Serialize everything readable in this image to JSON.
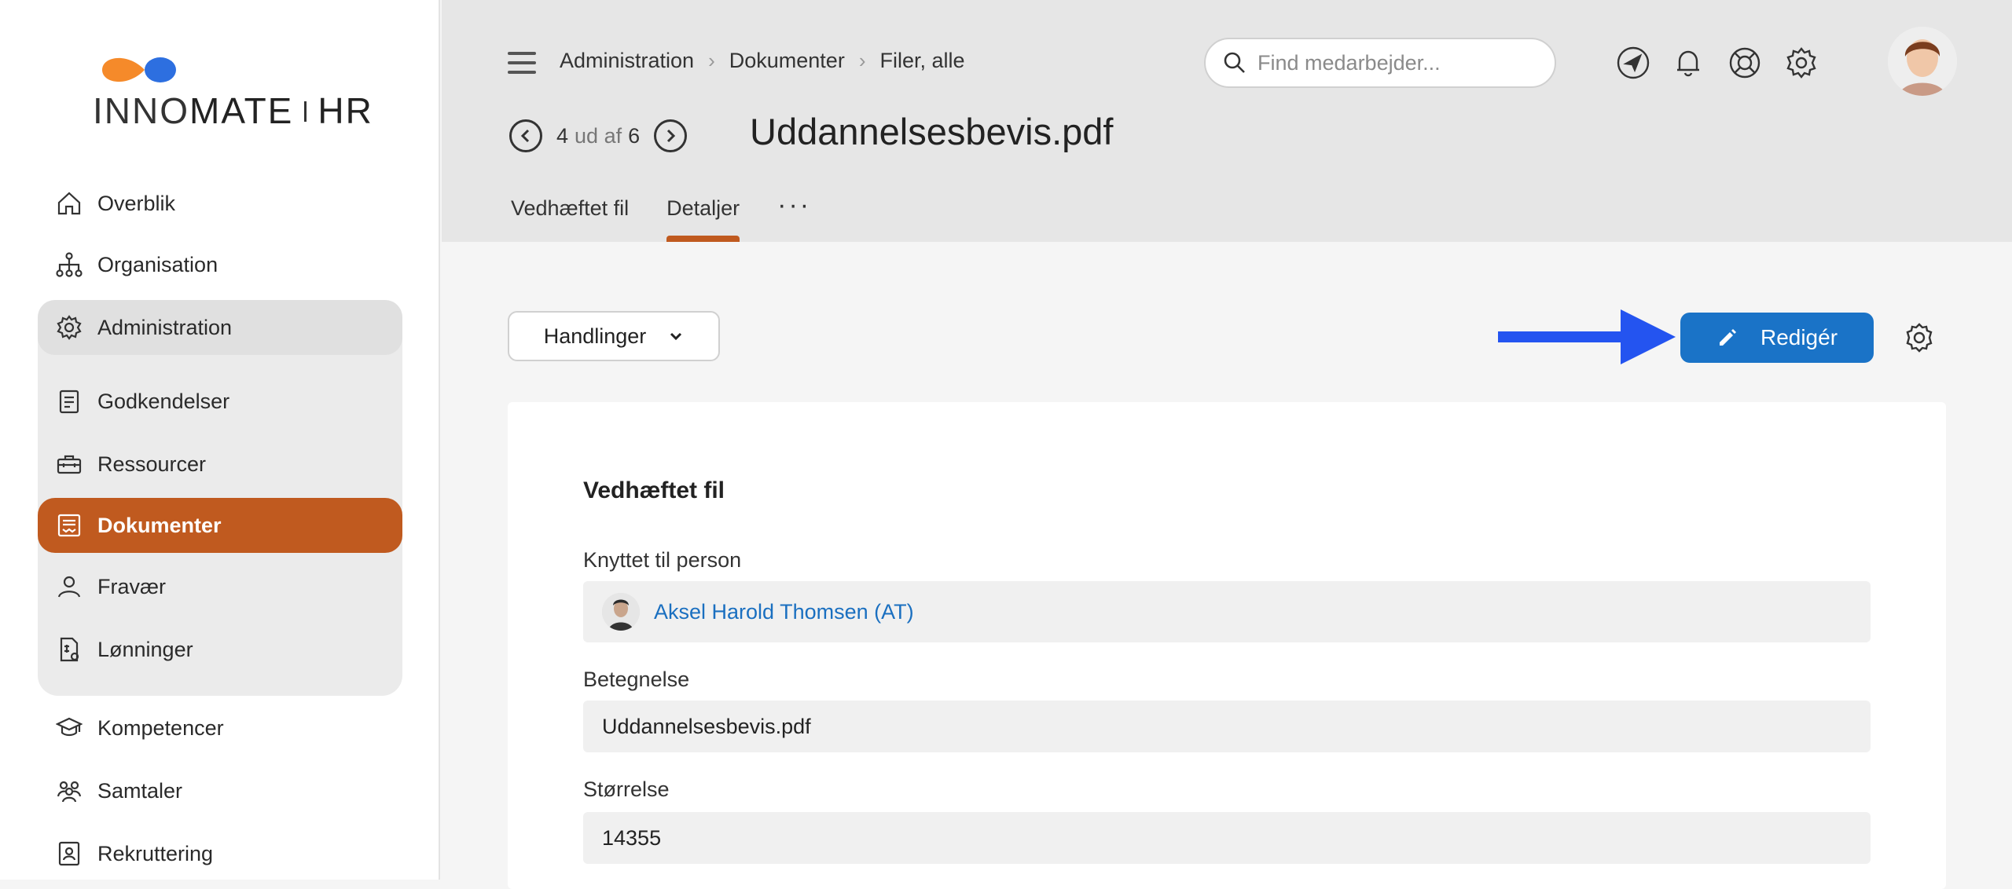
{
  "brand": {
    "name_a": "INNO",
    "name_b": "MATE",
    "name_c": "HR",
    "accent": "#c05a1f",
    "logo_orange": "#f58a2a",
    "logo_blue": "#2d6fe0"
  },
  "sidebar": {
    "items": [
      {
        "label": "Overblik",
        "icon": "home-icon"
      },
      {
        "label": "Organisation",
        "icon": "org-chart-icon"
      },
      {
        "label": "Administration",
        "icon": "gear-icon"
      },
      {
        "label": "Godkendelser",
        "icon": "clipboard-icon"
      },
      {
        "label": "Ressourcer",
        "icon": "toolbox-icon"
      },
      {
        "label": "Dokumenter",
        "icon": "document-icon"
      },
      {
        "label": "Fravær",
        "icon": "person-icon"
      },
      {
        "label": "Lønninger",
        "icon": "payslip-icon"
      },
      {
        "label": "Kompetencer",
        "icon": "graduation-cap-icon"
      },
      {
        "label": "Samtaler",
        "icon": "people-icon"
      },
      {
        "label": "Rekruttering",
        "icon": "id-card-icon"
      }
    ]
  },
  "header": {
    "breadcrumbs": [
      "Administration",
      "Dokumenter",
      "Filer, alle"
    ],
    "search_placeholder": "Find medarbejder...",
    "pager": {
      "current": "4",
      "of_text": "ud af",
      "total": "6"
    },
    "title": "Uddannelsesbevis.pdf",
    "tabs": [
      "Vedhæftet fil",
      "Detaljer"
    ],
    "tab_more": "···"
  },
  "toolbar": {
    "actions_label": "Handlinger",
    "edit_label": "Redigér",
    "edit_color": "#1a73c7",
    "arrow_color": "#2454f0"
  },
  "details": {
    "section_title": "Vedhæftet fil",
    "fields": [
      {
        "label": "Knyttet til person",
        "value": "Aksel Harold Thomsen (AT)"
      },
      {
        "label": "Betegnelse",
        "value": "Uddannelsesbevis.pdf"
      },
      {
        "label": "Størrelse",
        "value": "14355"
      }
    ]
  }
}
